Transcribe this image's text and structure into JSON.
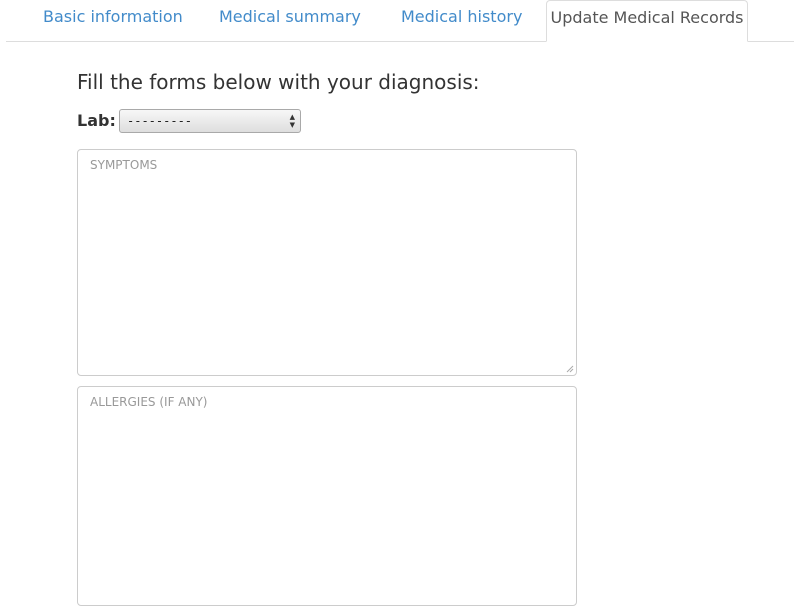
{
  "tabs": [
    {
      "label": "Basic information",
      "active": false
    },
    {
      "label": "Medical summary",
      "active": false
    },
    {
      "label": "Medical history",
      "active": false
    },
    {
      "label": "Update Medical Records",
      "active": true
    }
  ],
  "form": {
    "heading": "Fill the forms below with your diagnosis:",
    "lab_label": "Lab:",
    "lab_selected": "---------",
    "symptoms_placeholder": "SYMPTOMS",
    "allergies_placeholder": "ALLERGIES (IF ANY)"
  },
  "colors": {
    "link": "#428bca",
    "active_tab_text": "#555555",
    "border": "#dddddd",
    "placeholder": "#999999"
  }
}
